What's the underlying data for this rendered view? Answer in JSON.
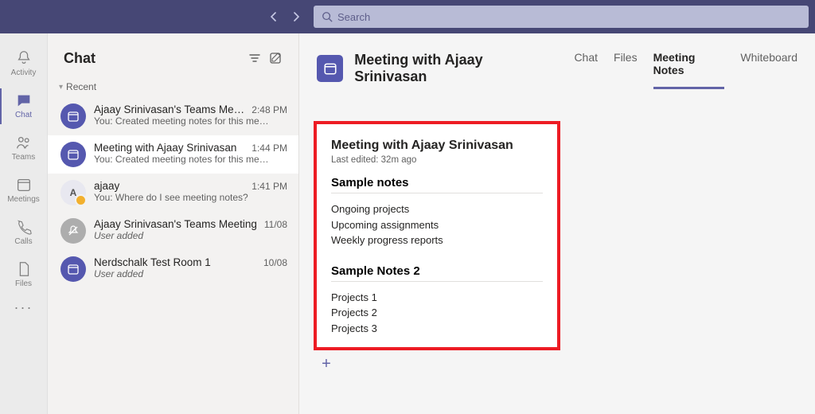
{
  "search": {
    "placeholder": "Search"
  },
  "apprail": {
    "items": [
      {
        "label": "Activity"
      },
      {
        "label": "Chat"
      },
      {
        "label": "Teams"
      },
      {
        "label": "Meetings"
      },
      {
        "label": "Calls"
      },
      {
        "label": "Files"
      }
    ]
  },
  "chatPanel": {
    "heading": "Chat",
    "sectionLabel": "Recent",
    "items": [
      {
        "title": "Ajaay Srinivasan's Teams Mee…",
        "time": "2:48 PM",
        "preview": "You: Created meeting notes for this me…",
        "avatar": "cal"
      },
      {
        "title": "Meeting with Ajaay Srinivasan",
        "time": "1:44 PM",
        "preview": "You: Created meeting notes for this me…",
        "avatar": "cal"
      },
      {
        "title": "ajaay",
        "time": "1:41 PM",
        "preview": "You: Where do I see meeting notes?",
        "avatar": "A"
      },
      {
        "title": "Ajaay Srinivasan's Teams Meeting",
        "time": "11/08",
        "preview": "User added",
        "avatar": "mute"
      },
      {
        "title": "Nerdschalk Test Room 1",
        "time": "10/08",
        "preview": "User added",
        "avatar": "cal"
      }
    ]
  },
  "header": {
    "title": "Meeting with Ajaay Srinivasan",
    "tabs": [
      {
        "label": "Chat"
      },
      {
        "label": "Files"
      },
      {
        "label": "Meeting Notes"
      },
      {
        "label": "Whiteboard"
      }
    ]
  },
  "notes": {
    "title": "Meeting with Ajaay Srinivasan",
    "meta": "Last edited: 32m ago",
    "section1": {
      "title": "Sample notes",
      "lines": [
        "Ongoing projects",
        "Upcoming assignments",
        "Weekly progress reports"
      ]
    },
    "section2": {
      "title": "Sample Notes 2",
      "lines": [
        "Projects 1",
        "Projects 2",
        "Projects 3"
      ]
    }
  }
}
